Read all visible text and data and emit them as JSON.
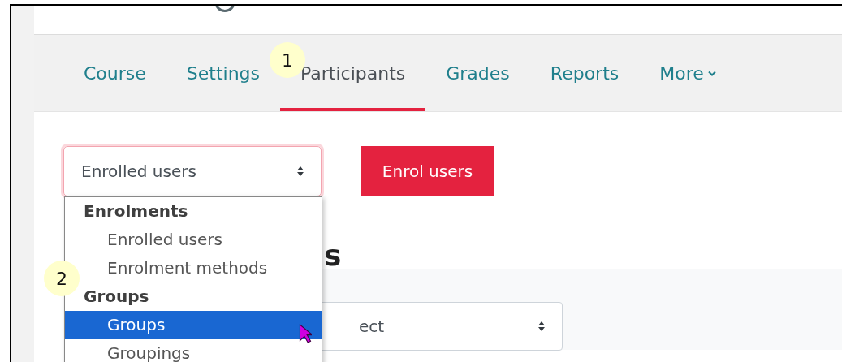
{
  "tabs": [
    {
      "label": "Course",
      "selected": false,
      "kind": "link"
    },
    {
      "label": "Settings",
      "selected": false,
      "kind": "link"
    },
    {
      "label": "Participants",
      "selected": true,
      "kind": "link"
    },
    {
      "label": "Grades",
      "selected": false,
      "kind": "link"
    },
    {
      "label": "Reports",
      "selected": false,
      "kind": "link"
    },
    {
      "label": "More",
      "selected": false,
      "kind": "menu"
    }
  ],
  "view_select": {
    "value": "Enrolled users"
  },
  "enrol_button": "Enrol users",
  "dropdown": [
    {
      "label": "Enrolments",
      "options": [
        {
          "label": "Enrolled users",
          "selected": false
        },
        {
          "label": "Enrolment methods",
          "selected": false
        }
      ]
    },
    {
      "label": "Groups",
      "options": [
        {
          "label": "Groups",
          "selected": true
        },
        {
          "label": "Groupings",
          "selected": false
        }
      ]
    }
  ],
  "heading_fragment": "s",
  "filter_select": {
    "value": "ect"
  },
  "callouts": [
    "1",
    "2"
  ]
}
